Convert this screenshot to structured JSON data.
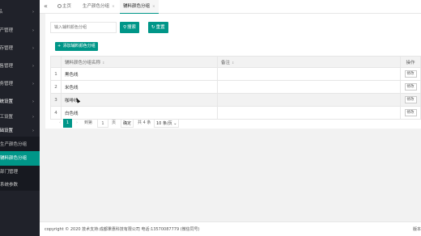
{
  "sidebar": {
    "items": [
      {
        "label": "商品",
        "arrow": "›"
      },
      {
        "label": "生产管理",
        "arrow": "›"
      },
      {
        "label": "库存管理",
        "arrow": "›"
      },
      {
        "label": "销售管理",
        "arrow": "›"
      },
      {
        "label": "财务管理",
        "arrow": "›"
      },
      {
        "label": "系统设置",
        "arrow": "›"
      },
      {
        "label": "员工设置",
        "arrow": "›"
      },
      {
        "label": "基础设置",
        "arrow": "›"
      }
    ],
    "sub_items": [
      "生产颜色分组",
      "辅料颜色分组",
      "部门管理",
      "系统参数"
    ]
  },
  "topbar": {
    "collapse_icon": "«",
    "tabs": [
      {
        "label": "主页"
      },
      {
        "label": "生产颜色分组",
        "close": "×"
      },
      {
        "label": "辅料颜色分组",
        "close": "×"
      }
    ]
  },
  "search": {
    "placeholder": "输入辅料颜色分组",
    "search_label": "搜索",
    "reset_label": "重置",
    "add_label": "添加辅料颜色分组"
  },
  "table": {
    "columns": [
      "辅料颜色分组名称",
      "备注",
      "操作"
    ],
    "sort_icon": "⇕",
    "rows": [
      {
        "index": "1",
        "name": "黑色线",
        "remark": "",
        "op": "修改"
      },
      {
        "index": "2",
        "name": "米色线",
        "remark": "",
        "op": "修改"
      },
      {
        "index": "3",
        "name": "咖啡线",
        "remark": "",
        "op": "修改"
      },
      {
        "index": "4",
        "name": "白色线",
        "remark": "",
        "op": "修改"
      }
    ]
  },
  "pager": {
    "prev": "‹",
    "current": "1",
    "next": "›",
    "goto_label": "到第",
    "goto_value": "1",
    "page_unit": "页",
    "confirm": "确定",
    "total": "共 4 条",
    "page_size": "10 条/页 ⌄"
  },
  "footer": {
    "copyright": "copyright © 2020 技术支持:成都秉惠科技有限公司 电话:13570087779 (微信同号)",
    "version": "版本"
  },
  "colors": {
    "accent": "#009688",
    "sidebar": "#20222a"
  }
}
